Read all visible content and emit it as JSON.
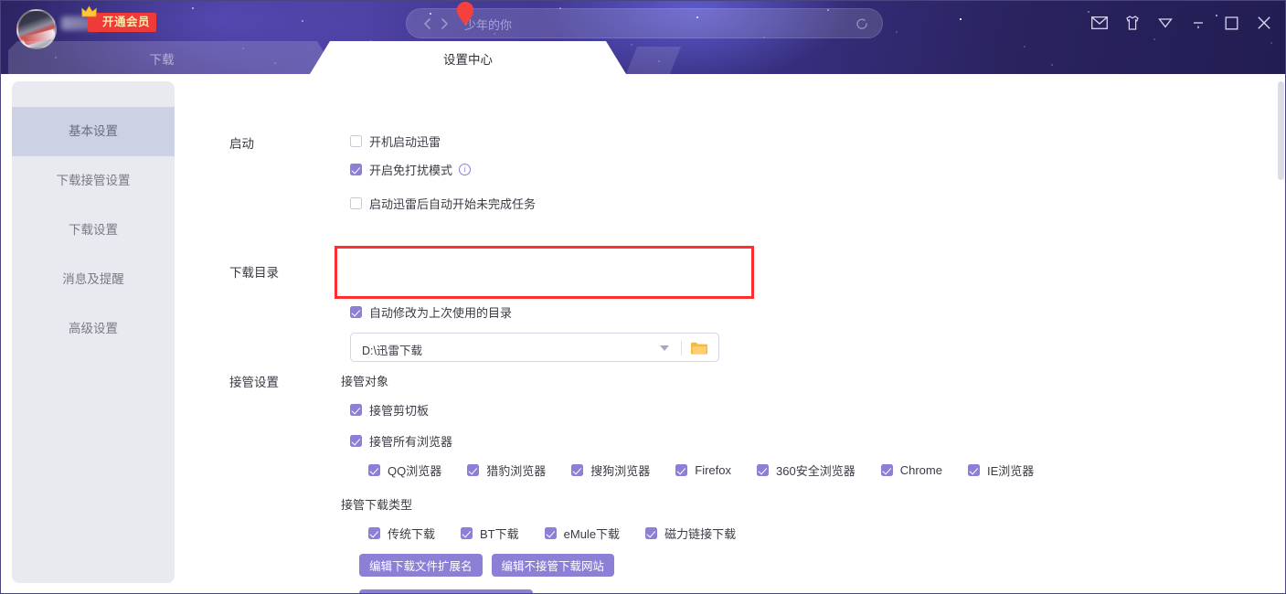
{
  "window": {
    "controls": [
      {
        "name": "mail-icon",
        "label": "邮件"
      },
      {
        "name": "skin-icon",
        "label": "皮肤"
      },
      {
        "name": "menu-icon",
        "label": "菜单"
      },
      {
        "name": "minimize-icon",
        "label": "最小化"
      },
      {
        "name": "maximize-icon",
        "label": "最大化"
      },
      {
        "name": "close-icon",
        "label": "关闭"
      }
    ]
  },
  "account": {
    "vip_label": "开通会员"
  },
  "search": {
    "placeholder": "少年的你"
  },
  "tabs": [
    {
      "label": "下载",
      "active": false
    },
    {
      "label": "设置中心",
      "active": true
    }
  ],
  "sidebar": {
    "items": [
      {
        "label": "基本设置",
        "active": true
      },
      {
        "label": "下载接管设置",
        "active": false
      },
      {
        "label": "下载设置",
        "active": false
      },
      {
        "label": "消息及提醒",
        "active": false
      },
      {
        "label": "高级设置",
        "active": false
      }
    ]
  },
  "settings": {
    "startup": {
      "label": "启动",
      "options": [
        {
          "label": "开机启动迅雷",
          "checked": false,
          "info": false
        },
        {
          "label": "开启免打扰模式",
          "checked": true,
          "info": true
        },
        {
          "label": "启动迅雷后自动开始未完成任务",
          "checked": false,
          "info": false
        }
      ]
    },
    "download_dir": {
      "label": "下载目录",
      "value": "D:\\迅雷下载",
      "browse_icon": "folder-icon",
      "dropdown_icon": "chevron-down-icon",
      "auto_option": {
        "label": "自动修改为上次使用的目录",
        "checked": true
      }
    },
    "takeover": {
      "label": "接管设置",
      "target_head": "接管对象",
      "targets": [
        {
          "label": "接管剪切板",
          "checked": true
        },
        {
          "label": "接管所有浏览器",
          "checked": true
        }
      ],
      "browsers": [
        {
          "label": "QQ浏览器",
          "checked": true
        },
        {
          "label": "猎豹浏览器",
          "checked": true
        },
        {
          "label": "搜狗浏览器",
          "checked": true
        },
        {
          "label": "Firefox",
          "checked": true
        },
        {
          "label": "360安全浏览器",
          "checked": true
        },
        {
          "label": "Chrome",
          "checked": true
        },
        {
          "label": "IE浏览器",
          "checked": true
        }
      ],
      "types_head": "接管下载类型",
      "types": [
        {
          "label": "传统下载",
          "checked": true
        },
        {
          "label": "BT下载",
          "checked": true
        },
        {
          "label": "eMule下载",
          "checked": true
        },
        {
          "label": "磁力链接下载",
          "checked": true
        }
      ],
      "buttons": [
        {
          "label": "编辑下载文件扩展名"
        },
        {
          "label": "编辑不接管下载网站"
        }
      ]
    }
  },
  "colors": {
    "accent": "#8b7fd6",
    "header_purple": "#3b3388",
    "vip_red": "#ef3a3a",
    "annotation_red": "#ff2d2d",
    "folder_orange": "#f7b844",
    "sidebar_bg": "#e9eaf0",
    "sidebar_active": "#ccd1e4"
  }
}
